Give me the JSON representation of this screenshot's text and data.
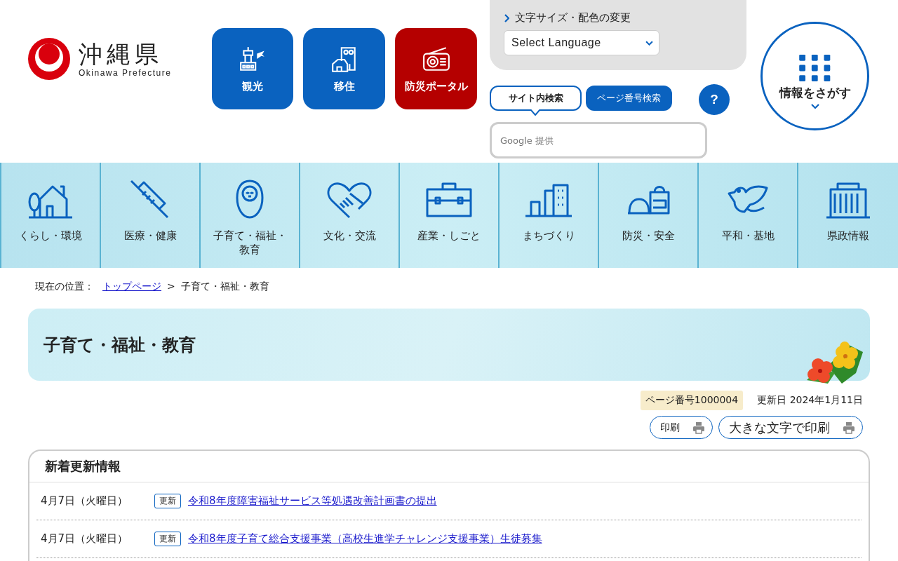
{
  "logo": {
    "title": "沖縄県",
    "subtitle": "Okinawa Prefecture"
  },
  "quick_links": [
    {
      "label": "観光",
      "color": "#0a62bf"
    },
    {
      "label": "移住",
      "color": "#0a62bf"
    },
    {
      "label": "防災ポータル",
      "color": "#b50000"
    }
  ],
  "tools": {
    "text_settings": "文字サイズ・配色の変更",
    "language": "Select Language"
  },
  "search": {
    "tabs": [
      {
        "label": "サイト内検索",
        "selected": true
      },
      {
        "label": "ページ番号検索",
        "selected": false
      }
    ],
    "help": "?",
    "placeholder": "Google 提供"
  },
  "find_info": "情報をさがす",
  "categories": [
    {
      "label": "くらし・環境"
    },
    {
      "label": "医療・健康"
    },
    {
      "label": "子育て・福祉・教育"
    },
    {
      "label": "文化・交流"
    },
    {
      "label": "産業・しごと"
    },
    {
      "label": "まちづくり"
    },
    {
      "label": "防災・安全"
    },
    {
      "label": "平和・基地"
    },
    {
      "label": "県政情報"
    }
  ],
  "breadcrumb": {
    "prefix": "現在の位置：",
    "link": "トップページ",
    "separator": ">",
    "current": "子育て・福祉・教育"
  },
  "page_title": "子育て・福祉・教育",
  "meta": {
    "page_number": "ページ番号1000004",
    "updated": "更新日 2024年1月11日"
  },
  "print_buttons": [
    "印刷",
    "大きな文字で印刷"
  ],
  "news": {
    "title": "新着更新情報",
    "items": [
      {
        "date": "4月7日（火曜日）",
        "tag": "更新",
        "title": "令和8年度障害福祉サービス等処遇改善計画書の提出"
      },
      {
        "date": "4月7日（火曜日）",
        "tag": "更新",
        "title": "令和8年度子育て総合支援事業（高校生進学チャレンジ支援事業）生徒募集"
      }
    ]
  }
}
